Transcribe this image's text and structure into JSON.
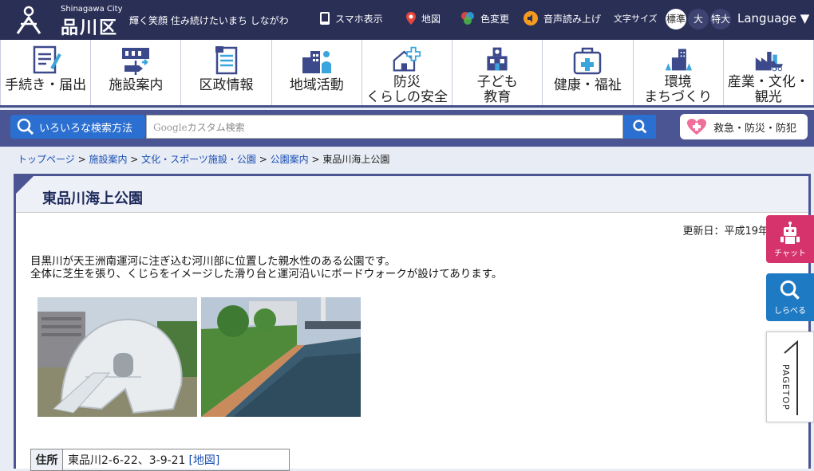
{
  "header": {
    "city_en": "Shinagawa City",
    "city_jp": "品川区",
    "slogan": "輝く笑顔 住み続けたいまち しながわ",
    "smartphone": "スマホ表示",
    "map": "地図",
    "color_change": "色変更",
    "voice": "音声読み上げ",
    "font_size_label": "文字サイズ",
    "font_sizes": [
      "標準",
      "大",
      "特大"
    ],
    "language": "Language ▼"
  },
  "nav": {
    "items": [
      {
        "label": "手続き・届出",
        "icon": "form-icon"
      },
      {
        "label": "施設案内",
        "icon": "signpost-icon"
      },
      {
        "label": "区政情報",
        "icon": "document-icon"
      },
      {
        "label": "地域活動",
        "icon": "community-icon"
      },
      {
        "label": "防災\nくらしの安全",
        "icon": "safety-house-icon"
      },
      {
        "label": "子ども\n教育",
        "icon": "school-icon"
      },
      {
        "label": "健康・福祉",
        "icon": "medical-kit-icon"
      },
      {
        "label": "環境\nまちづくり",
        "icon": "city-trees-icon"
      },
      {
        "label": "産業・文化・\n観光",
        "icon": "factory-icon"
      }
    ]
  },
  "search": {
    "button_label": "いろいろな検索方法",
    "google_label": "Google",
    "placeholder": "カスタム検索",
    "emergency": "救急・防災・防犯"
  },
  "breadcrumb": {
    "items": [
      "トップページ",
      "施設案内",
      "文化・スポーツ施設・公園",
      "公園案内"
    ],
    "current": "東品川海上公園"
  },
  "main": {
    "title": "東品川海上公園",
    "updated": "更新日：平成19年",
    "desc1": "目黒川が天王洲南運河に注ぎ込む河川部に位置した親水性のある公園です。",
    "desc2": "全体に芝生を張り、くじらをイメージした滑り台と運河沿いにボードウォークが設けてあります。",
    "address_label": "住所",
    "address": "東品川2-6-22、3-9-21",
    "map_link": "[地図]"
  },
  "side": {
    "chat": "チャット",
    "search": "しらべる",
    "pagetop": "PAGETOP"
  },
  "colors": {
    "header": "#2a2f56",
    "nav_border": "#45508a",
    "accent": "#2b6fd0",
    "chat": "#d6336c",
    "search_side": "#1f7ac4"
  }
}
